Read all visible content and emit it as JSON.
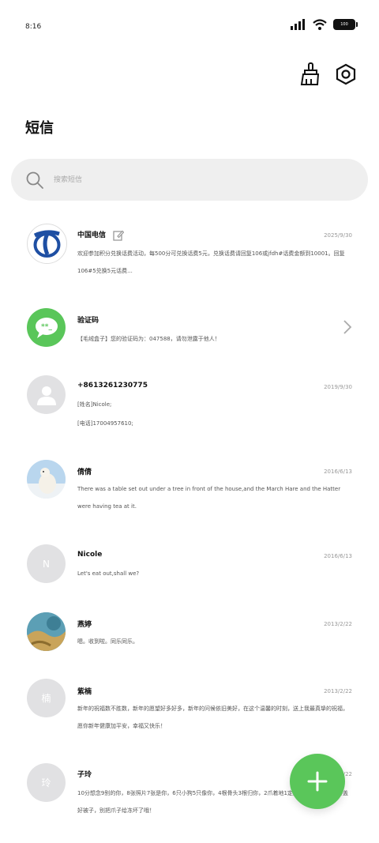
{
  "status": {
    "time": "8:16",
    "battery": "100"
  },
  "header": {
    "title": "短信",
    "clean_icon": "broom-icon",
    "settings_icon": "hexagon-gear-icon"
  },
  "search": {
    "placeholder": "搜索短信"
  },
  "conversations": [
    {
      "name": "中国电信",
      "date": "2025/9/30",
      "preview": "欢迎参加积分兑换话费活动，每500分可兑换话费5元，兑换话费请回复106或jfdh#话费金额到10001。回复106#5兑换5元话费..."
    },
    {
      "name": "验证码",
      "preview": "【毛绒盒子】您的验证码为：047588，请勿泄露于他人！"
    },
    {
      "name": "+8613261230775",
      "date": "2019/9/30",
      "line1": "[姓名]Nicole;",
      "line2": "[电话]17004957610;"
    },
    {
      "name": "倩倩",
      "date": "2016/6/13",
      "preview": "There was a table set out under a tree in front of the house,and the March Hare and the Hatter were having tea at it."
    },
    {
      "name": "Nicole",
      "date": "2016/6/13",
      "avatar_letter": "N",
      "preview": "Let's eat out,shall we?"
    },
    {
      "name": "燕婷",
      "date": "2013/2/22",
      "preview": "嗯。收到啦。同乐同乐。"
    },
    {
      "name": "紫楠",
      "date": "2013/2/22",
      "avatar_letter": "楠",
      "preview": "新年的祝福数不胜数，新年的愿望好多好多，新年的问候依旧美好，在这个温馨的时刻，送上我最真挚的祝福，愿你新年健康加平安，幸福又快乐！"
    },
    {
      "name": "子玲",
      "date": "2013/2/22",
      "avatar_letter": "玲",
      "preview": "10分想念9别的你，8张照片7张是你，6只小狗5只像你，4根骨头3根归你，2爪着地1定是你。冬天来了记得盖好被子，别把爪子给冻坏了哦！"
    }
  ],
  "fab": {
    "icon": "plus-icon"
  },
  "colors": {
    "accent": "#5ac65a",
    "telecom_blue": "#1e4fa3",
    "search_bg": "#efefef"
  }
}
